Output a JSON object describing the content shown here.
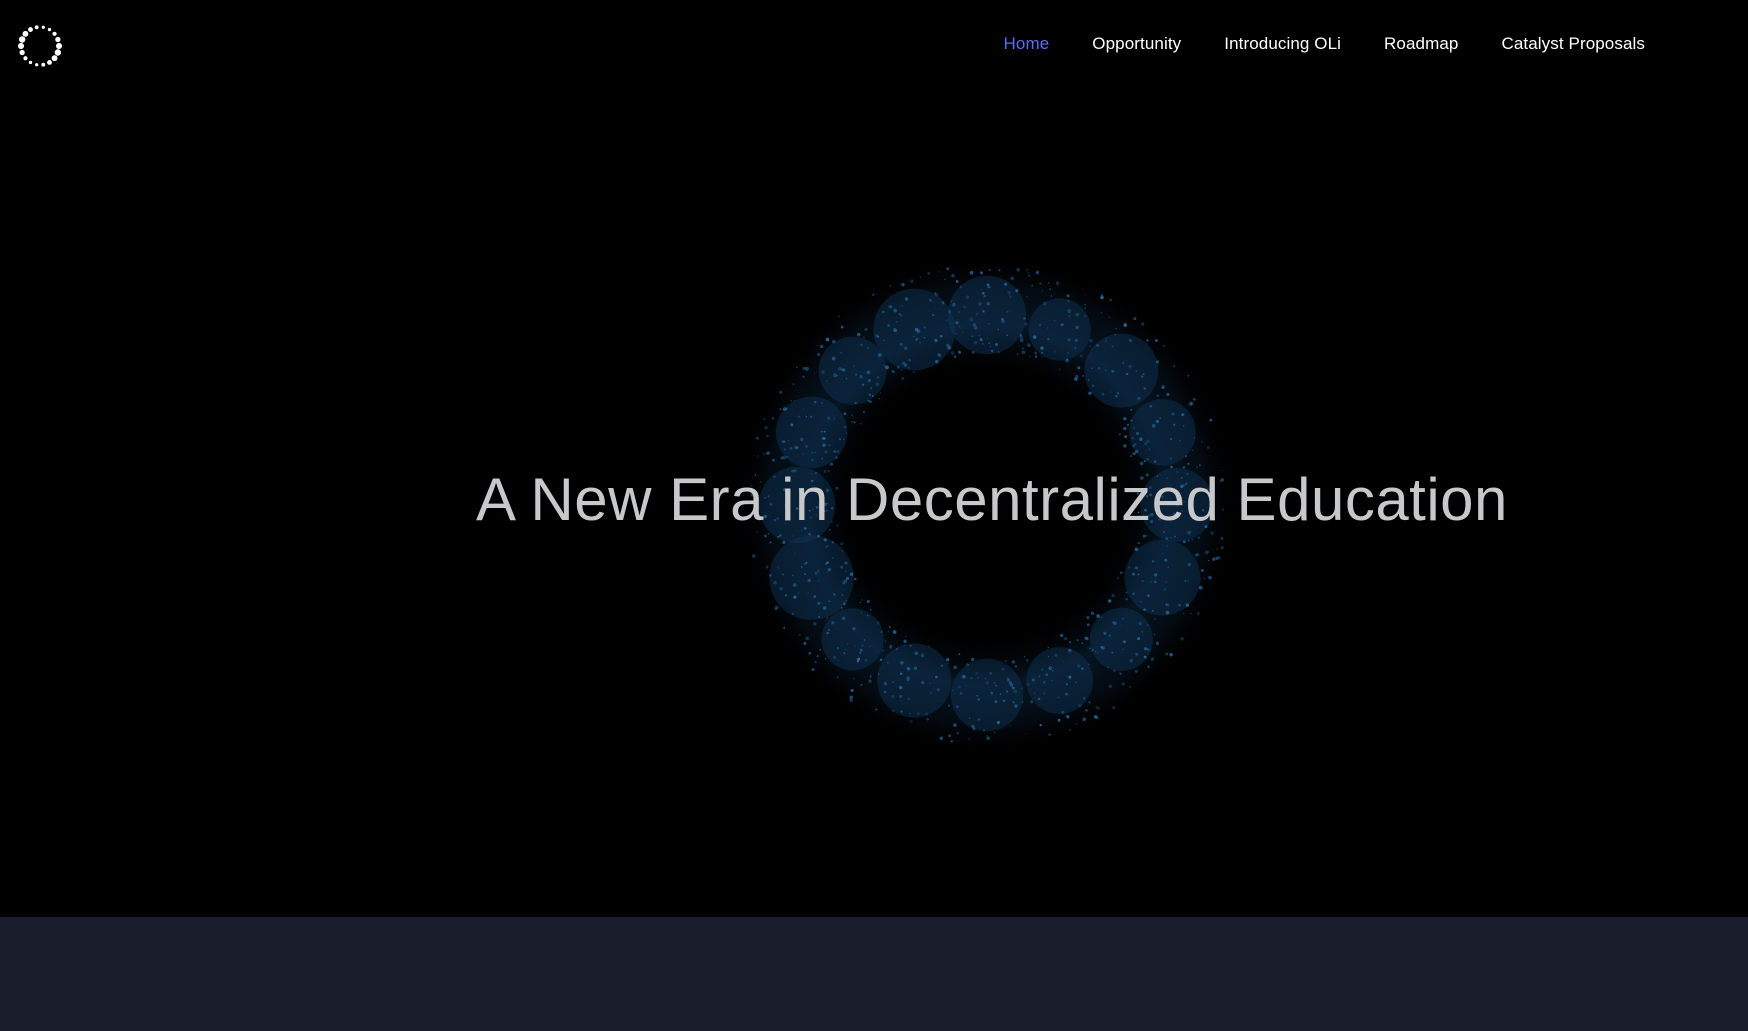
{
  "logo": {
    "icon": "dotted-ring-logo-icon",
    "color": "#ffffff"
  },
  "nav": {
    "items": [
      {
        "label": "Home",
        "active": true
      },
      {
        "label": "Opportunity",
        "active": false
      },
      {
        "label": "Introducing OLi",
        "active": false
      },
      {
        "label": "Roadmap",
        "active": false
      },
      {
        "label": "Catalyst Proposals",
        "active": false
      }
    ],
    "active_color": "#5b6cf0",
    "text_color": "#ffffff"
  },
  "hero": {
    "title": "A New Era in Decentralized Education",
    "title_color": "#c7c8ca",
    "background": "#000000",
    "decoration": "particle-ring-graphic",
    "ring_color": "#1c5a8c"
  },
  "footer_band": {
    "background": "#1a1d2c"
  }
}
